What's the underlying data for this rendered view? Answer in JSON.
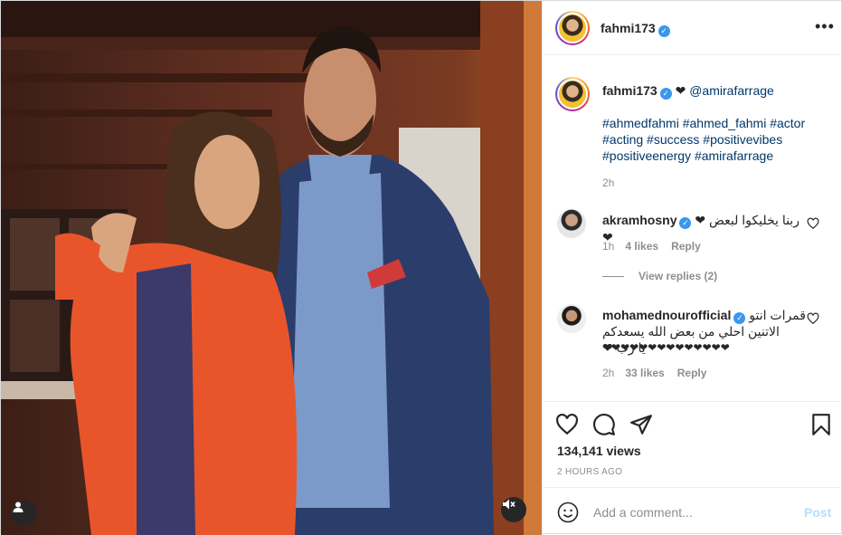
{
  "post": {
    "author": "fahmi173",
    "caption": {
      "author": "fahmi173",
      "heart": "❤",
      "mention": "@amirafarrage",
      "hashtags_line1": "#ahmedfahmi #ahmed_fahmi #actor",
      "hashtags_line2": "#acting #success #positivevibes",
      "hashtags_line3": "#positiveenergy #amirafarrage",
      "time": "2h"
    },
    "comments": [
      {
        "user": "akramhosny",
        "text": "ربنا يخليكوا لبعض ❤❤",
        "time": "1h",
        "likes": "4 likes",
        "reply": "Reply",
        "view_replies": "View replies (2)"
      },
      {
        "user": "mohamednourofficial",
        "text_line1": "قمرات انتو",
        "text_line2": "الاتنين احلي من بعض الله يسعدكم يا رب ❤",
        "text_line3": "❤❤❤❤❤❤❤❤❤❤❤❤❤❤",
        "time": "2h",
        "likes": "33 likes",
        "reply": "Reply"
      }
    ],
    "views": "134,141 views",
    "posted": "2 HOURS AGO",
    "add_comment_placeholder": "Add a comment...",
    "post_button": "Post"
  },
  "icons": {
    "more": "more-options-icon",
    "like": "heart-icon",
    "comment": "comment-icon",
    "share": "paper-plane-icon",
    "save": "bookmark-icon",
    "emoji": "smiley-icon",
    "mute": "speaker-muted-icon",
    "tags": "user-tag-icon"
  },
  "colors": {
    "verified": "#3897f0",
    "link": "#00376b",
    "muted": "#8e8e8e",
    "post_disabled": "#b2dffc"
  }
}
